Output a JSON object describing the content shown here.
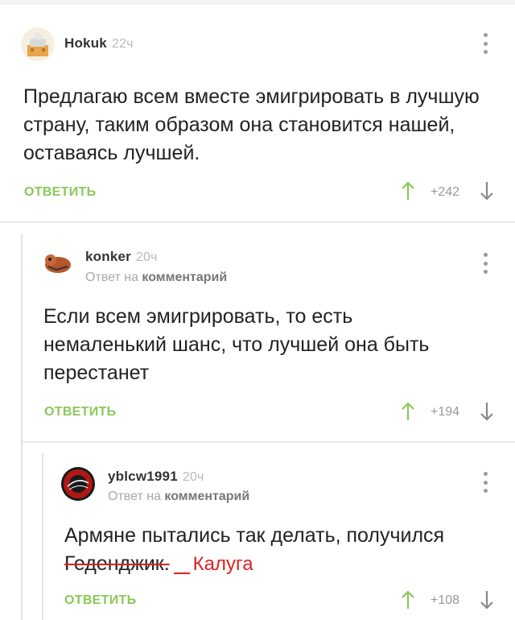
{
  "comments": [
    {
      "author": "Hokuk",
      "time": "22ч",
      "text": "Предлагаю всем вместе эмигрировать в лучшую страну, таким образом она становится нашей, оставаясь лучшей.",
      "reply_label": "ОТВЕТИТЬ",
      "rating": "+242"
    },
    {
      "author": "konker",
      "time": "20ч",
      "reply_to_prefix": "Ответ на",
      "reply_to_link": "комментарий",
      "text": "Если всем эмигрировать, то есть немаленький шанс, что лучшей она быть перестанет",
      "reply_label": "ОТВЕТИТЬ",
      "rating": "+194"
    },
    {
      "author": "yblcw1991",
      "time": "20ч",
      "reply_to_prefix": "Ответ на",
      "reply_to_link": "комментарий",
      "text_start": "Армяне пытались так делать, получился",
      "struck_word": "Геденджик.",
      "handwritten_correction": "Калуга",
      "reply_label": "ОТВЕТИТЬ",
      "rating": "+108"
    }
  ],
  "colors": {
    "accent": "#8ac858",
    "correction": "#e02020"
  },
  "icons": [
    "menu-dots-icon",
    "upvote-arrow-icon",
    "downvote-arrow-icon"
  ]
}
